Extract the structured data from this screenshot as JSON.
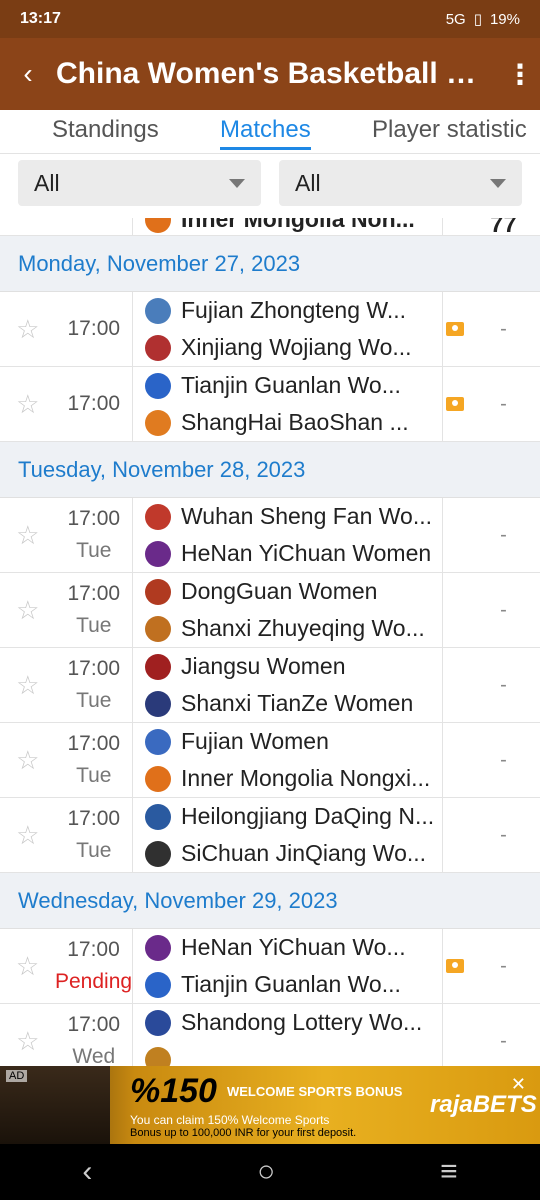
{
  "status": {
    "time": "13:17",
    "indicators": "5G",
    "battery": "19%"
  },
  "app_bar": {
    "title": "China Women's Basketball League",
    "back_icon": "arrow-back-icon",
    "more_icon": "more-vert-icon"
  },
  "tabs": [
    "Standings",
    "Matches",
    "Player statistic"
  ],
  "filters": [
    "All",
    "All"
  ],
  "partial_top": {
    "team": "Inner Mongolia Non...",
    "score": "77"
  },
  "days": [
    {
      "date": "Monday, November 27, 2023",
      "matches": [
        {
          "time": "17:00",
          "sub": "",
          "home": "Fujian Zhongteng W...",
          "away": "Xinjiang Wojiang Wo...",
          "live": true,
          "score": "-",
          "home_color": "#4a7dbb",
          "away_color": "#b03030"
        },
        {
          "time": "17:00",
          "sub": "",
          "home": "Tianjin Guanlan Wo...",
          "away": "ShangHai BaoShan ...",
          "live": true,
          "score": "-",
          "home_color": "#2a64c8",
          "away_color": "#e07b20"
        }
      ]
    },
    {
      "date": "Tuesday, November 28, 2023",
      "matches": [
        {
          "time": "17:00",
          "sub": "Tue",
          "home": "Wuhan Sheng Fan Wo...",
          "away": "HeNan YiChuan Women",
          "live": false,
          "score": "-",
          "home_color": "#c0392b",
          "away_color": "#6a2a8a"
        },
        {
          "time": "17:00",
          "sub": "Tue",
          "home": "DongGuan Women",
          "away": "Shanxi Zhuyeqing Wo...",
          "live": false,
          "score": "-",
          "home_color": "#b03a20",
          "away_color": "#c07020"
        },
        {
          "time": "17:00",
          "sub": "Tue",
          "home": "Jiangsu Women",
          "away": "Shanxi TianZe Women",
          "live": false,
          "score": "-",
          "home_color": "#a02020",
          "away_color": "#2a3a7a"
        },
        {
          "time": "17:00",
          "sub": "Tue",
          "home": "Fujian Women",
          "away": "Inner Mongolia Nongxi...",
          "live": false,
          "score": "-",
          "home_color": "#3a6ac0",
          "away_color": "#e0701a"
        },
        {
          "time": "17:00",
          "sub": "Tue",
          "home": "Heilongjiang DaQing N...",
          "away": "SiChuan JinQiang Wo...",
          "live": false,
          "score": "-",
          "home_color": "#2a5aa0",
          "away_color": "#303030"
        }
      ]
    },
    {
      "date": "Wednesday, November 29, 2023",
      "matches": [
        {
          "time": "17:00",
          "sub": "Pending",
          "home": "HeNan YiChuan Wo...",
          "away": "Tianjin Guanlan Wo...",
          "live": true,
          "score": "-",
          "home_color": "#6a2a8a",
          "away_color": "#2a64c8"
        },
        {
          "time": "17:00",
          "sub": "Wed",
          "home": "Shandong Lottery Wo...",
          "away": "",
          "live": false,
          "score": "-",
          "home_color": "#2a4a9a",
          "away_color": "#c08020"
        }
      ]
    }
  ],
  "ad": {
    "label": "AD",
    "amount": "%150",
    "headline": "WELCOME SPORTS BONUS",
    "line2": "You can claim 150% Welcome Sports",
    "line3": "Bonus up to 100,000 INR for your first deposit.",
    "brand": "rajaBETS"
  },
  "nav": {
    "back": "‹",
    "home": "○",
    "recents": "≡"
  }
}
